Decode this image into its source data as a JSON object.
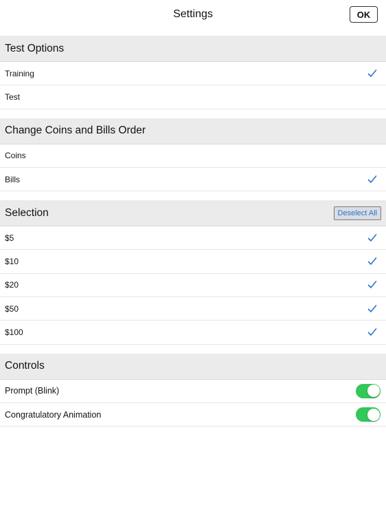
{
  "navbar": {
    "title": "Settings",
    "ok_label": "OK"
  },
  "sections": {
    "test_options": {
      "title": "Test Options",
      "items": [
        {
          "label": "Training",
          "checked": true
        },
        {
          "label": "Test",
          "checked": false
        }
      ]
    },
    "order": {
      "title": "Change Coins and Bills Order",
      "items": [
        {
          "label": "Coins",
          "checked": false
        },
        {
          "label": "Bills",
          "checked": true
        }
      ]
    },
    "selection": {
      "title": "Selection",
      "deselect_label": "Deselect All",
      "items": [
        {
          "label": "$5",
          "checked": true
        },
        {
          "label": "$10",
          "checked": true
        },
        {
          "label": "$20",
          "checked": true
        },
        {
          "label": "$50",
          "checked": true
        },
        {
          "label": "$100",
          "checked": true
        }
      ]
    },
    "controls": {
      "title": "Controls",
      "items": [
        {
          "label": "Prompt (Blink)",
          "on": true
        },
        {
          "label": "Congratulatory Animation",
          "on": true
        }
      ]
    }
  },
  "colors": {
    "accent": "#2b74c9",
    "toggle_on": "#34c759",
    "header_bg": "#ebebeb"
  }
}
